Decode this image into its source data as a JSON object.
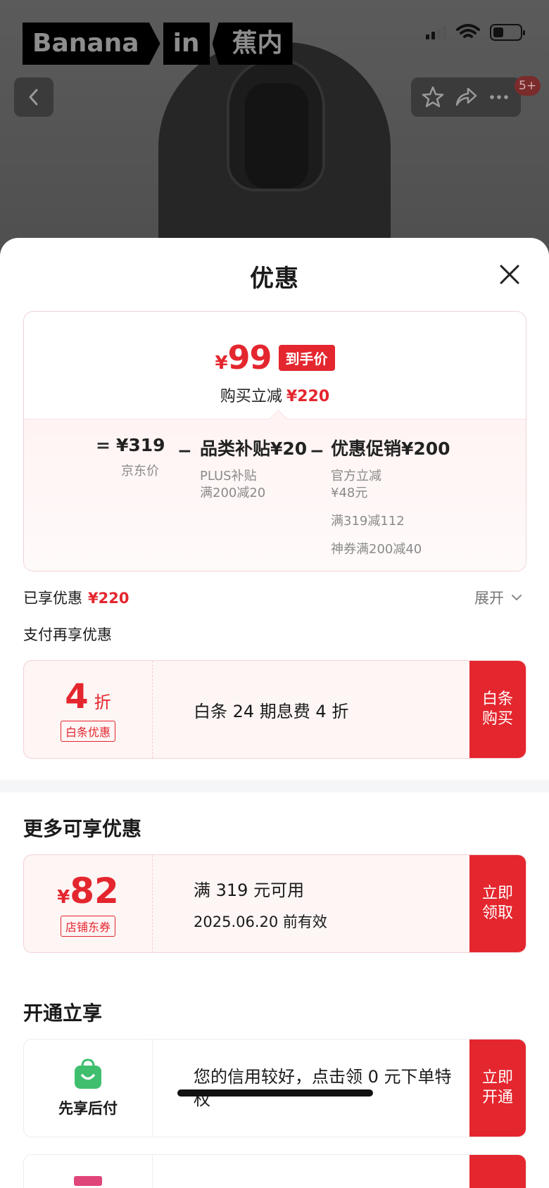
{
  "brand": {
    "part1": "Banana",
    "part2": "in",
    "part3": "蕉内"
  },
  "header": {
    "badge": "5+"
  },
  "sheet": {
    "title": "优惠",
    "summary": {
      "currency": "¥",
      "final_price": "99",
      "price_tag": "到手价",
      "cut_label": "购买立减",
      "cut_amount": "¥220"
    },
    "breakdown": {
      "equals": "=",
      "jd_price": "¥319",
      "jd_label": "京东价",
      "minus": "−",
      "subsidy": "品类补贴¥20",
      "subsidy_sub1": "PLUS补贴",
      "subsidy_sub2": "满200减20",
      "promo": "优惠促销¥200",
      "promo_sub1": "官方立减",
      "promo_sub2": "¥48元",
      "promo_sub3": "满319减112",
      "promo_sub4": "神券满200减40"
    },
    "enjoyed_label": "已享优惠",
    "enjoyed_amount": "¥220",
    "expand_label": "展开",
    "pay_more_label": "支付再享优惠",
    "baitiao": {
      "value": "4",
      "unit": "折",
      "tag": "白条优惠",
      "desc": "白条 24 期息费 4 折",
      "cta": "白条购买"
    },
    "more_title": "更多可享优惠",
    "shop_coupon": {
      "currency": "¥",
      "value": "82",
      "tag": "店铺东券",
      "line1": "满 319 元可用",
      "line2": "2025.06.20 前有效",
      "cta": "立即领取"
    },
    "open_title": "开通立享",
    "paylater": {
      "label": "先享后付",
      "desc": "您的信用较好，点击领 0 元下单特权",
      "cta": "立即开通"
    }
  },
  "colors": {
    "accent": "#e4262e",
    "coupon_bg": "#fef5f5"
  }
}
